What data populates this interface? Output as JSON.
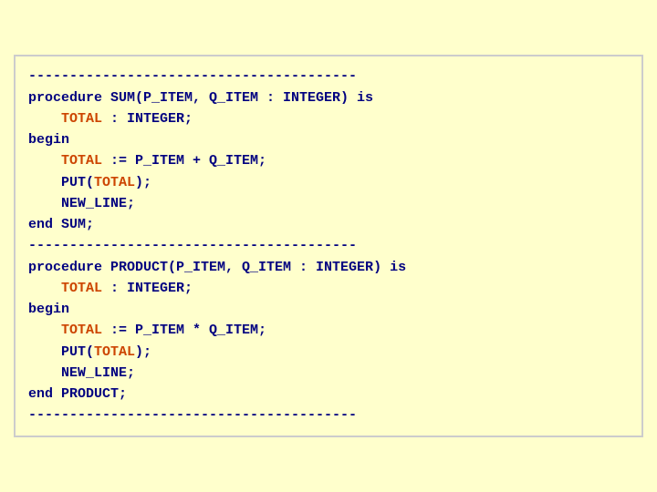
{
  "code": {
    "divider": "----------------------------------------",
    "lines": [
      {
        "id": "div1",
        "type": "divider"
      },
      {
        "id": "l1",
        "type": "mixed"
      },
      {
        "id": "l2",
        "type": "mixed"
      },
      {
        "id": "l3",
        "type": "plain",
        "text": "begin"
      },
      {
        "id": "l4",
        "type": "mixed"
      },
      {
        "id": "l5",
        "type": "mixed"
      },
      {
        "id": "l6",
        "type": "plain",
        "text": "    NEW_LINE;"
      },
      {
        "id": "l7",
        "type": "plain",
        "text": "end SUM;"
      },
      {
        "id": "div2",
        "type": "divider"
      },
      {
        "id": "l8",
        "type": "mixed"
      },
      {
        "id": "l9",
        "type": "mixed"
      },
      {
        "id": "l10",
        "type": "plain",
        "text": "begin"
      },
      {
        "id": "l11",
        "type": "mixed"
      },
      {
        "id": "l12",
        "type": "mixed"
      },
      {
        "id": "l13",
        "type": "plain",
        "text": "    NEW_LINE;"
      },
      {
        "id": "l14",
        "type": "plain",
        "text": "end PRODUCT;"
      },
      {
        "id": "div3",
        "type": "divider"
      }
    ]
  }
}
